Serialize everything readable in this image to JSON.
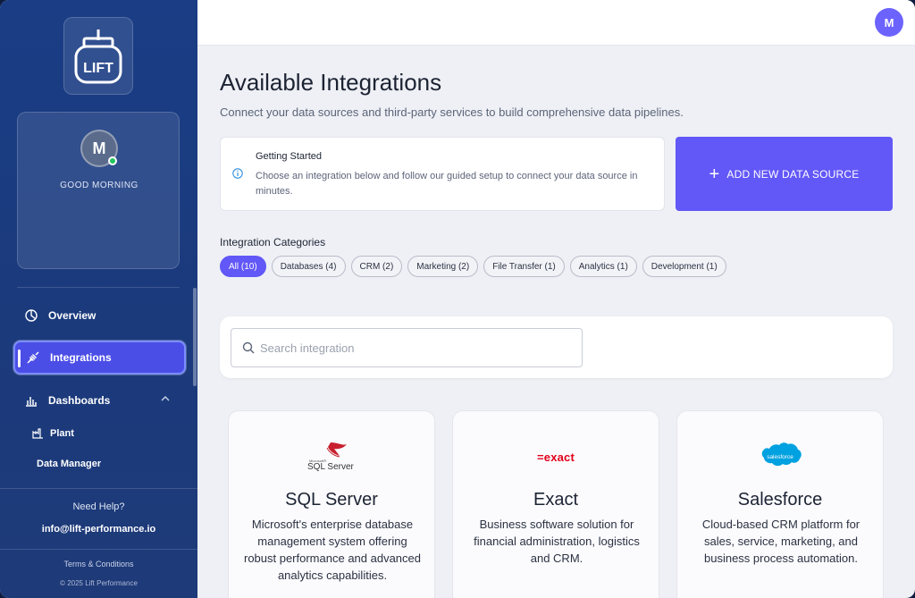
{
  "sidebar": {
    "logo_text": "LIFT",
    "user_initial": "M",
    "greeting": "GOOD MORNING",
    "nav": [
      {
        "label": "Overview",
        "icon": "pie-chart-icon"
      },
      {
        "label": "Integrations",
        "icon": "plug-icon",
        "active": true
      },
      {
        "label": "Dashboards",
        "icon": "bar-chart-icon",
        "expanded": true
      }
    ],
    "sub_items": [
      {
        "label": "Plant",
        "icon": "factory-icon"
      },
      {
        "label": "Data Manager"
      }
    ],
    "help_title": "Need Help?",
    "help_email": "info@lift-performance.io",
    "terms": "Terms & Conditions",
    "copyright": "© 2025 Lift Performance"
  },
  "topbar": {
    "user_initial": "M"
  },
  "main": {
    "title": "Available Integrations",
    "subtitle": "Connect your data sources and third-party services to build comprehensive data pipelines.",
    "info": {
      "title": "Getting Started",
      "text": "Choose an integration below and follow our guided setup to connect your data source in minutes."
    },
    "add_button": "ADD NEW DATA SOURCE",
    "categories_title": "Integration Categories",
    "categories": [
      {
        "label": "All (10)",
        "active": true
      },
      {
        "label": "Databases (4)"
      },
      {
        "label": "CRM (2)"
      },
      {
        "label": "Marketing (2)"
      },
      {
        "label": "File Transfer (1)"
      },
      {
        "label": "Analytics (1)"
      },
      {
        "label": "Development (1)"
      }
    ],
    "search": {
      "placeholder": "Search integration",
      "value": ""
    },
    "integrations": [
      {
        "name": "SQL Server",
        "logo_text": "SQL Server",
        "logo_small": "Microsoft®",
        "description": "Microsoft's enterprise database management system offering robust performance and advanced analytics capabilities."
      },
      {
        "name": "Exact",
        "logo_text": "=exact",
        "description": "Business software solution for financial administration, logistics and CRM."
      },
      {
        "name": "Salesforce",
        "logo_text": "salesforce",
        "description": "Cloud-based CRM platform for sales, service, marketing, and business process automation."
      }
    ]
  },
  "colors": {
    "accent": "#6257f7",
    "sidebar": "#1b3a7c",
    "exact_red": "#e2001a",
    "salesforce_blue": "#00a1e0"
  }
}
